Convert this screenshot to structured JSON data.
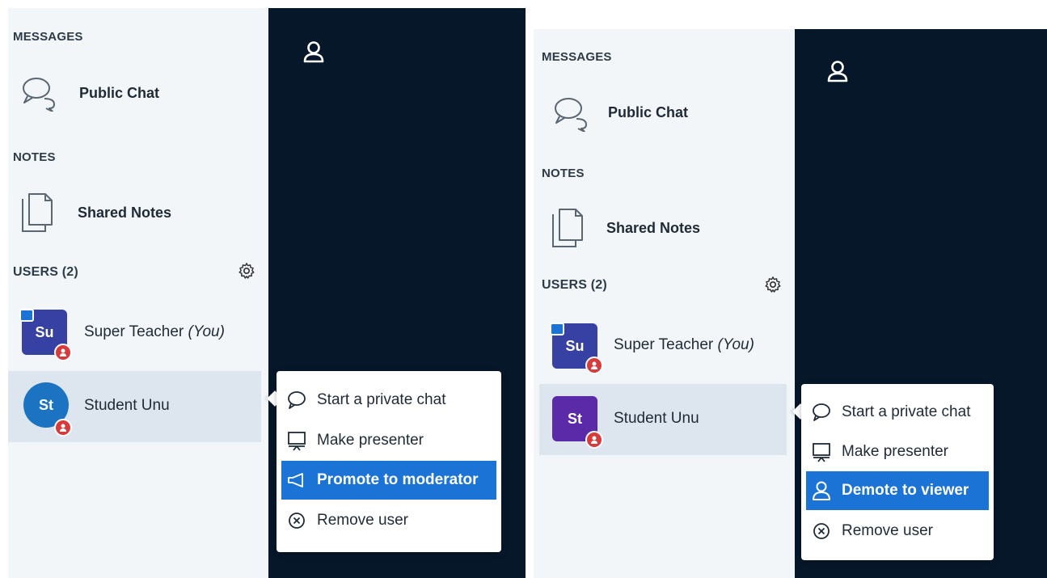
{
  "panels": [
    {
      "sections": {
        "messages": "MESSAGES",
        "public_chat": "Public Chat",
        "notes": "NOTES",
        "shared_notes": "Shared Notes",
        "users": "USERS (2)"
      },
      "users": [
        {
          "initials": "Su",
          "name": "Super Teacher",
          "suffix": "(You)",
          "color": "#3741a3"
        },
        {
          "initials": "St",
          "name": "Student Unu",
          "suffix": "",
          "color": "#1b73c1"
        }
      ],
      "menu": [
        {
          "label": "Start a private chat",
          "icon": "chat-bubble-icon"
        },
        {
          "label": "Make presenter",
          "icon": "presentation-icon"
        },
        {
          "label": "Promote to moderator",
          "icon": "megaphone-icon",
          "active": true
        },
        {
          "label": "Remove user",
          "icon": "circle-x-icon"
        }
      ]
    },
    {
      "sections": {
        "messages": "MESSAGES",
        "public_chat": "Public Chat",
        "notes": "NOTES",
        "shared_notes": "Shared Notes",
        "users": "USERS (2)"
      },
      "users": [
        {
          "initials": "Su",
          "name": "Super Teacher",
          "suffix": "(You)",
          "color": "#3741a3"
        },
        {
          "initials": "St",
          "name": "Student Unu",
          "suffix": "",
          "color": "#5a2aa8"
        }
      ],
      "menu": [
        {
          "label": "Start a private chat",
          "icon": "chat-bubble-icon"
        },
        {
          "label": "Make presenter",
          "icon": "presentation-icon"
        },
        {
          "label": "Demote to viewer",
          "icon": "user-icon",
          "active": true
        },
        {
          "label": "Remove user",
          "icon": "circle-x-icon"
        }
      ]
    }
  ],
  "colors": {
    "sidebar_bg": "#f3f6f9",
    "dark_bg": "#06172a",
    "accent": "#1b73d6",
    "moderator_badge": "#d73b3b"
  }
}
